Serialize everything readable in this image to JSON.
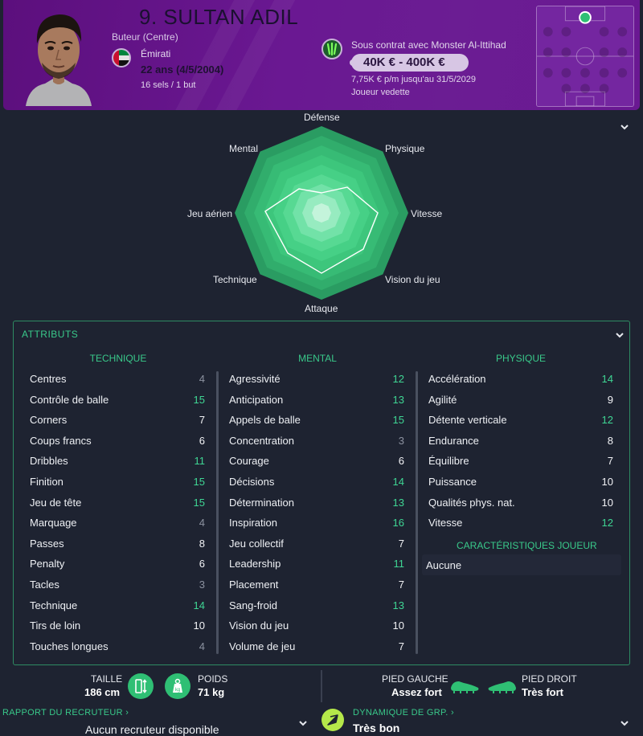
{
  "header": {
    "name": "9. SULTAN ADIL",
    "position": "Buteur (Centre)",
    "nationality": "Émirati",
    "age": "22 ans (4/5/2004)",
    "caps": "16 sels / 1 but",
    "contract": "Sous contrat avec Monster Al-Ittihad",
    "value": "40K € - 400K €",
    "wage": "7,75K € p/m jusqu'au 31/5/2029",
    "status": "Joueur vedette",
    "colors": {
      "header": "#6a1892",
      "accent": "#39c98a"
    }
  },
  "radar": {
    "labels": [
      "Défense",
      "Physique",
      "Vitesse",
      "Vision du jeu",
      "Attaque",
      "Technique",
      "Jeu aérien",
      "Mental"
    ]
  },
  "attributes": {
    "title": "ATTRIBUTS",
    "technical": {
      "heading": "TECHNIQUE",
      "items": [
        {
          "name": "Centres",
          "value": "4",
          "tier": "lo"
        },
        {
          "name": "Contrôle de balle",
          "value": "15",
          "tier": "hi"
        },
        {
          "name": "Corners",
          "value": "7",
          "tier": "mid"
        },
        {
          "name": "Coups francs",
          "value": "6",
          "tier": "mid"
        },
        {
          "name": "Dribbles",
          "value": "11",
          "tier": "hi"
        },
        {
          "name": "Finition",
          "value": "15",
          "tier": "hi"
        },
        {
          "name": "Jeu de tête",
          "value": "15",
          "tier": "hi"
        },
        {
          "name": "Marquage",
          "value": "4",
          "tier": "lo"
        },
        {
          "name": "Passes",
          "value": "8",
          "tier": "mid"
        },
        {
          "name": "Penalty",
          "value": "6",
          "tier": "mid"
        },
        {
          "name": "Tacles",
          "value": "3",
          "tier": "lo"
        },
        {
          "name": "Technique",
          "value": "14",
          "tier": "hi"
        },
        {
          "name": "Tirs de loin",
          "value": "10",
          "tier": "mid"
        },
        {
          "name": "Touches longues",
          "value": "4",
          "tier": "lo"
        }
      ]
    },
    "mental": {
      "heading": "MENTAL",
      "items": [
        {
          "name": "Agressivité",
          "value": "12",
          "tier": "hi"
        },
        {
          "name": "Anticipation",
          "value": "13",
          "tier": "hi"
        },
        {
          "name": "Appels de balle",
          "value": "15",
          "tier": "hi"
        },
        {
          "name": "Concentration",
          "value": "3",
          "tier": "lo"
        },
        {
          "name": "Courage",
          "value": "6",
          "tier": "mid"
        },
        {
          "name": "Décisions",
          "value": "14",
          "tier": "hi"
        },
        {
          "name": "Détermination",
          "value": "13",
          "tier": "hi"
        },
        {
          "name": "Inspiration",
          "value": "16",
          "tier": "hi"
        },
        {
          "name": "Jeu collectif",
          "value": "7",
          "tier": "mid"
        },
        {
          "name": "Leadership",
          "value": "11",
          "tier": "hi"
        },
        {
          "name": "Placement",
          "value": "7",
          "tier": "mid"
        },
        {
          "name": "Sang-froid",
          "value": "13",
          "tier": "hi"
        },
        {
          "name": "Vision du jeu",
          "value": "10",
          "tier": "mid"
        },
        {
          "name": "Volume de jeu",
          "value": "7",
          "tier": "mid"
        }
      ]
    },
    "physical": {
      "heading": "PHYSIQUE",
      "items": [
        {
          "name": "Accélération",
          "value": "14",
          "tier": "hi"
        },
        {
          "name": "Agilité",
          "value": "9",
          "tier": "mid"
        },
        {
          "name": "Détente verticale",
          "value": "12",
          "tier": "hi"
        },
        {
          "name": "Endurance",
          "value": "8",
          "tier": "mid"
        },
        {
          "name": "Équilibre",
          "value": "7",
          "tier": "mid"
        },
        {
          "name": "Puissance",
          "value": "10",
          "tier": "mid"
        },
        {
          "name": "Qualités phys. nat.",
          "value": "10",
          "tier": "mid"
        },
        {
          "name": "Vitesse",
          "value": "12",
          "tier": "hi"
        }
      ]
    },
    "traits": {
      "heading": "CARACTÉRISTIQUES JOUEUR",
      "value": "Aucune"
    }
  },
  "bottom": {
    "height_label": "TAILLE",
    "height_value": "186 cm",
    "weight_label": "POIDS",
    "weight_value": "71 kg",
    "left_foot_label": "PIED GAUCHE",
    "left_foot_value": "Assez fort",
    "right_foot_label": "PIED DROIT",
    "right_foot_value": "Très fort",
    "report_link": "RAPPORT DU RECRUTEUR",
    "report_value": "Aucun recruteur disponible",
    "dynamics_link": "DYNAMIQUE DE GRP.",
    "dynamics_value": "Très bon"
  }
}
